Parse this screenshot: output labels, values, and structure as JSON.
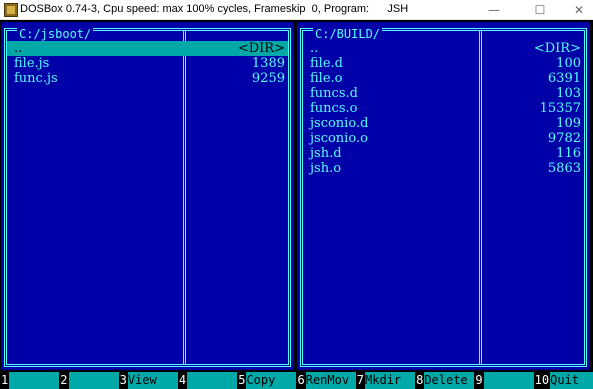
{
  "window": {
    "title": "DOSBox 0.74-3, Cpu speed: max 100% cycles, Frameskip  0, Program:      JSH",
    "icon": "dosbox-icon",
    "minimize": "—",
    "maximize": "☐",
    "close": "✕"
  },
  "colors": {
    "panel_bg": "#0000a8",
    "frame": "#55ffff",
    "selection": "#00a8a8",
    "fkey_label_bg": "#00a8a8"
  },
  "left_panel": {
    "title": "C:/jsboot/",
    "rows": [
      {
        "name": "..",
        "size": "<DIR>",
        "selected": true
      },
      {
        "name": "file.js",
        "size": "1389"
      },
      {
        "name": "func.js",
        "size": "9259"
      }
    ]
  },
  "right_panel": {
    "title": "C:/BUILD/",
    "rows": [
      {
        "name": "..",
        "size": "<DIR>"
      },
      {
        "name": "file.d",
        "size": "100"
      },
      {
        "name": "file.o",
        "size": "6391"
      },
      {
        "name": "funcs.d",
        "size": "103"
      },
      {
        "name": "funcs.o",
        "size": "15357"
      },
      {
        "name": "jsconio.d",
        "size": "109"
      },
      {
        "name": "jsconio.o",
        "size": "9782"
      },
      {
        "name": "jsh.d",
        "size": "116"
      },
      {
        "name": "jsh.o",
        "size": "5863"
      }
    ]
  },
  "function_keys": [
    {
      "num": "1",
      "label": ""
    },
    {
      "num": "2",
      "label": ""
    },
    {
      "num": "3",
      "label": "View"
    },
    {
      "num": "4",
      "label": ""
    },
    {
      "num": "5",
      "label": "Copy"
    },
    {
      "num": "6",
      "label": "RenMov"
    },
    {
      "num": "7",
      "label": "Mkdir"
    },
    {
      "num": "8",
      "label": "Delete"
    },
    {
      "num": "9",
      "label": ""
    },
    {
      "num": "10",
      "label": "Quit"
    }
  ]
}
